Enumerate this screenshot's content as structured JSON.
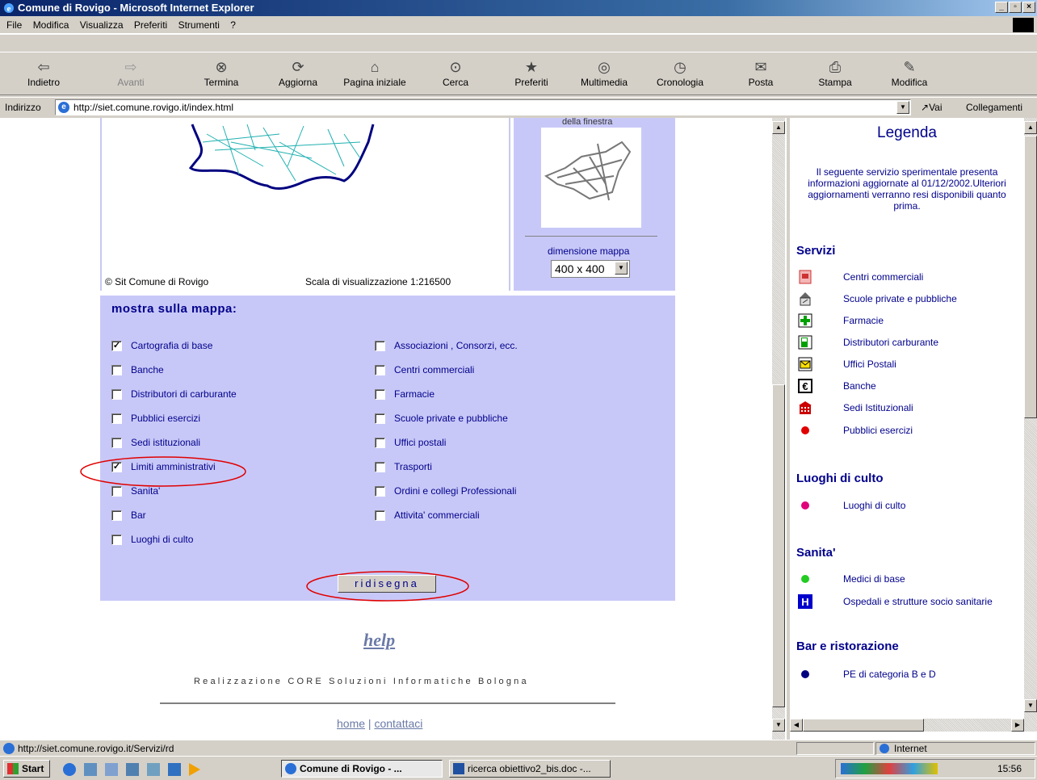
{
  "window": {
    "title": "Comune di Rovigo - Microsoft Internet Explorer"
  },
  "menu": [
    "File",
    "Modifica",
    "Visualizza",
    "Preferiti",
    "Strumenti",
    "?"
  ],
  "toolbar": [
    {
      "label": "Indietro",
      "icon": "back-arrow-icon",
      "enabled": true
    },
    {
      "label": "Avanti",
      "icon": "forward-arrow-icon",
      "enabled": false
    },
    {
      "label": "Termina",
      "icon": "stop-icon",
      "enabled": true
    },
    {
      "label": "Aggiorna",
      "icon": "refresh-icon",
      "enabled": true
    },
    {
      "label": "Pagina iniziale",
      "icon": "home-icon",
      "enabled": true
    },
    {
      "label": "Cerca",
      "icon": "search-icon",
      "enabled": true
    },
    {
      "label": "Preferiti",
      "icon": "favorites-icon",
      "enabled": true
    },
    {
      "label": "Multimedia",
      "icon": "multimedia-icon",
      "enabled": true
    },
    {
      "label": "Cronologia",
      "icon": "history-icon",
      "enabled": true
    },
    {
      "label": "Posta",
      "icon": "mail-icon",
      "enabled": true
    },
    {
      "label": "Stampa",
      "icon": "print-icon",
      "enabled": true
    },
    {
      "label": "Modifica",
      "icon": "edit-icon",
      "enabled": true
    }
  ],
  "address": {
    "label": "Indirizzo",
    "url": "http://siet.comune.rovigo.it/index.html",
    "go": "Vai",
    "links": "Collegamenti"
  },
  "map": {
    "copyright": "© Sit Comune di Rovigo",
    "scale": "Scala di visualizzazione 1:216500",
    "minimap_caption": "della finestra",
    "size_label": "dimensione mappa",
    "size_value": "400 x 400"
  },
  "options": {
    "heading": "mostra sulla mappa:",
    "left": [
      {
        "label": "Cartografia di base",
        "checked": true
      },
      {
        "label": "Banche",
        "checked": false
      },
      {
        "label": "Distributori di carburante",
        "checked": false
      },
      {
        "label": "Pubblici esercizi",
        "checked": false
      },
      {
        "label": "Sedi istituzionali",
        "checked": false
      },
      {
        "label": "Limiti amministrativi",
        "checked": true
      },
      {
        "label": "Sanita'",
        "checked": false
      },
      {
        "label": "Bar",
        "checked": false
      },
      {
        "label": "Luoghi di culto",
        "checked": false
      }
    ],
    "right": [
      {
        "label": "Associazioni , Consorzi, ecc.",
        "checked": false
      },
      {
        "label": "Centri commerciali",
        "checked": false
      },
      {
        "label": "Farmacie",
        "checked": false
      },
      {
        "label": "Scuole private e pubbliche",
        "checked": false
      },
      {
        "label": "Uffici postali",
        "checked": false
      },
      {
        "label": "Trasporti",
        "checked": false
      },
      {
        "label": "Ordini e collegi Professionali",
        "checked": false
      },
      {
        "label": "Attivita' commerciali",
        "checked": false
      }
    ],
    "redraw": "ridisegna"
  },
  "footer": {
    "help": "help",
    "credits": "Realizzazione CORE Soluzioni Informatiche Bologna",
    "home": "home",
    "sep": "|",
    "contact": "contattaci"
  },
  "legend": {
    "title": "Legenda",
    "intro": "Il seguente servizio sperimentale presenta informazioni aggiornate al 01/12/2002.Ulteriori aggiornamenti verranno resi disponibili quanto prima.",
    "servizi": "Servizi",
    "servizi_items": [
      "Centri commerciali",
      "Scuole private e pubbliche",
      "Farmacie",
      "Distributori carburante",
      "Uffici Postali",
      "Banche",
      "Sedi Istituzionali",
      "Pubblici esercizi"
    ],
    "culto": "Luoghi di culto",
    "culto_items": [
      "Luoghi di culto"
    ],
    "sanita": "Sanita'",
    "sanita_items": [
      "Medici di base",
      "Ospedali e strutture socio sanitarie"
    ],
    "bar": "Bar e ristorazione",
    "bar_items": [
      "PE di categoria B e D"
    ],
    "colors": {
      "shop": "#cc3333",
      "red_dot": "#e00000",
      "magenta_dot": "#e0007a",
      "green_dot": "#22cc22",
      "navy_dot": "#000080",
      "hospital": "#0000cc"
    }
  },
  "status": {
    "url": "http://siet.comune.rovigo.it/Servizi/rd",
    "zone": "Internet"
  },
  "taskbar": {
    "start": "Start",
    "tasks": [
      "Comune di Rovigo - ...",
      "ricerca obiettivo2_bis.doc -..."
    ],
    "clock": "15:56"
  }
}
